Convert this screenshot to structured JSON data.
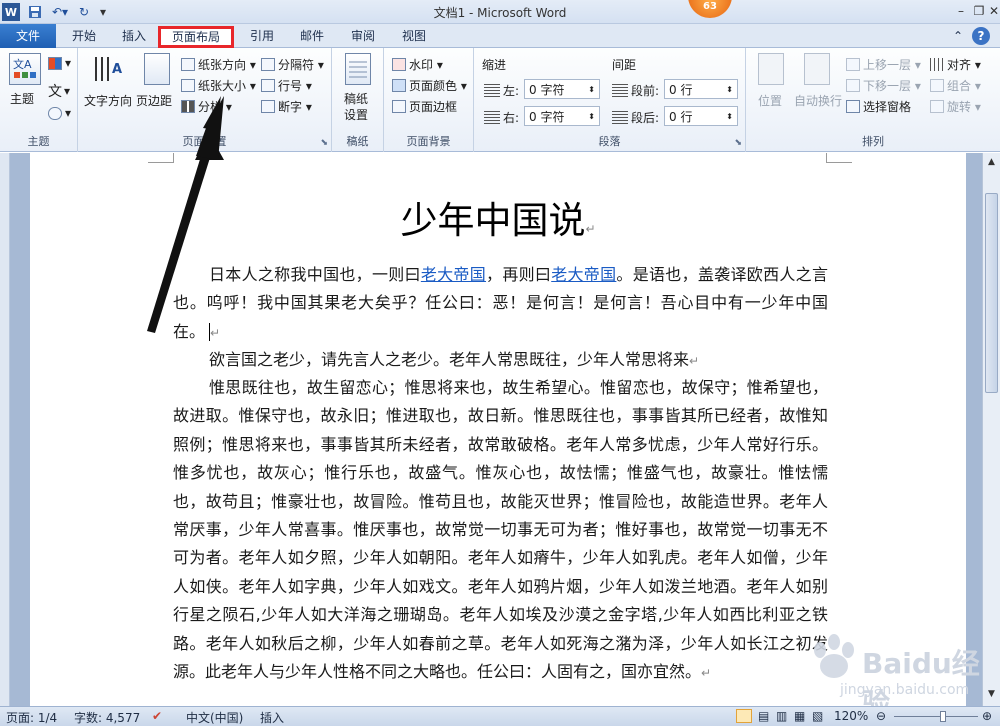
{
  "window": {
    "title": "文档1 - Microsoft Word",
    "badge": "63"
  },
  "tabs": [
    "文件",
    "开始",
    "插入",
    "页面布局",
    "引用",
    "邮件",
    "审阅",
    "视图"
  ],
  "ribbon": {
    "theme": {
      "btn": "主题",
      "group": "主题"
    },
    "page_setup": {
      "text_dir": "文字方向",
      "margins": "页边距",
      "orientation": "纸张方向",
      "size": "纸张大小",
      "columns": "分栏",
      "breaks": "分隔符",
      "line_numbers": "行号",
      "hyphenation": "断字",
      "group": "页面设置"
    },
    "paper": {
      "btn1": "稿纸",
      "btn2": "设置",
      "group": "稿纸"
    },
    "page_background": {
      "watermark": "水印",
      "page_color": "页面颜色",
      "borders": "页面边框",
      "group": "页面背景"
    },
    "paragraph": {
      "indent_label": "缩进",
      "left": "左:",
      "left_value": "0 字符",
      "right": "右:",
      "right_value": "0 字符",
      "spacing_label": "间距",
      "before": "段前:",
      "before_value": "0 行",
      "after": "段后:",
      "after_value": "0 行",
      "group": "段落"
    },
    "arrange": {
      "position": "位置",
      "wrap": "自动换行",
      "forward": "上移一层",
      "backward": "下移一层",
      "pane": "选择窗格",
      "align": "对齐",
      "group_btn": "组合",
      "rotate": "旋转",
      "group": "排列"
    }
  },
  "document": {
    "title": "少年中国说",
    "p1_a": "日本人之称我中国也，一则曰",
    "p1_link1": "老大帝国",
    "p1_b": "，再则曰",
    "p1_link2": "老大帝国",
    "p1_c": "。是语也，盖袭译欧西人之言也。呜呼！我中国其果老大矣乎？任公曰：恶！是何言！是何言！吾心目中有一少年中国在。",
    "p2": "欲言国之老少，请先言人之老少。老年人常思既往，少年人常思将来",
    "p3": "惟思既往也，故生留恋心；惟思将来也，故生希望心。惟留恋也，故保守；惟希望也，故进取。惟保守也，故永旧；惟进取也，故日新。惟思既往也，事事皆其所已经者，故惟知照例；惟思将来也，事事皆其所未经者，故常敢破格。老年人常多忧虑，少年人常好行乐。惟多忧也，故灰心；惟行乐也，故盛气。惟灰心也，故怯懦；惟盛气也，故豪壮。惟怯懦也，故苟且；惟豪壮也，故冒险。惟苟且也，故能灭世界；惟冒险也，故能造世界。老年人常厌事，少年人常喜事。惟厌事也，故常觉一切事无可为者；惟好事也，故常觉一切事无不可为者。老年人如夕照，少年人如朝阳。老年人如瘠牛，少年人如乳虎。老年人如僧，少年人如侠。老年人如字典，少年人如戏文。老年人如鸦片烟，少年人如泼兰地酒。老年人如别行星之陨石,少年人如大洋海之珊瑚岛。老年人如埃及沙漠之金字塔,少年人如西比利亚之铁路。老年人如秋后之柳，少年人如春前之草。老年人如死海之潴为泽，少年人如长江之初发源。此老年人与少年人性格不同之大略也。任公曰：人固有之，国亦宜然。"
  },
  "status": {
    "page": "页面: 1/4",
    "words": "字数: 4,577",
    "lang": "中文(中国)",
    "mode": "插入",
    "zoom": "120%"
  },
  "watermark": {
    "brand": "Baidu经验",
    "url": "jingyan.baidu.com"
  },
  "colors": {
    "file_tab": "#2b6cc4",
    "highlight": "#e8262a",
    "link": "#1a5bc4"
  }
}
